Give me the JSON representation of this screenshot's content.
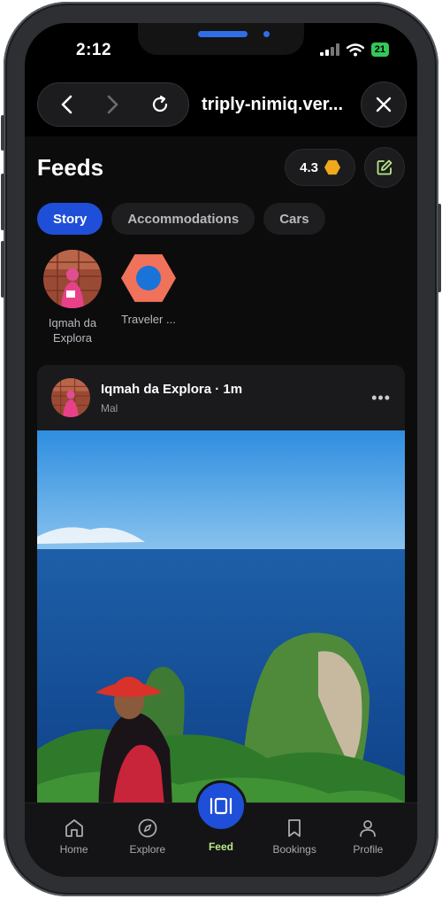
{
  "status_bar": {
    "time": "2:12",
    "battery": "21"
  },
  "browser": {
    "url": "triply-nimiq.ver..."
  },
  "header": {
    "title": "Feeds",
    "rating": "4.3"
  },
  "tabs": [
    {
      "label": "Story",
      "active": true
    },
    {
      "label": "Accommodations",
      "active": false
    },
    {
      "label": "Cars",
      "active": false
    }
  ],
  "stories": [
    {
      "label": "Iqmah da Explora"
    },
    {
      "label": "Traveler ..."
    }
  ],
  "post": {
    "author_time": "Iqmah da Explora · 1m",
    "location": "Mal",
    "more": "•••"
  },
  "bottom_nav": [
    {
      "label": "Home",
      "icon": "home-icon"
    },
    {
      "label": "Explore",
      "icon": "compass-icon"
    },
    {
      "label": "Feed",
      "icon": "feed-icon"
    },
    {
      "label": "Bookings",
      "icon": "bookmark-icon"
    },
    {
      "label": "Profile",
      "icon": "person-icon"
    }
  ],
  "colors": {
    "accent": "#1f4fd8",
    "feed_label": "#b8e986",
    "rating_coin": "#f0a81c"
  }
}
